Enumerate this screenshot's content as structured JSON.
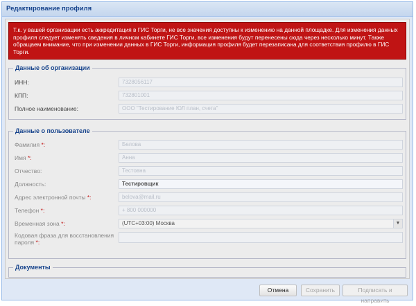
{
  "dialog": {
    "title": "Редактирование профиля"
  },
  "alert": {
    "text": "Т.к. у вашей организации есть аккредитация в ГИС Торги, не все значения доступны к изменению на данной площадке. Для изменения данных профиля следует изменять сведения в личном кабинете ГИС Торги, все изменения будут перенесены сюда через несколько минут. Также обращаем внимание, что при изменении данных в ГИС Торги, информация профиля будет перезаписана для соответствия профилю в ГИС Торги."
  },
  "org": {
    "legend": "Данные об организации",
    "inn_label": "ИНН:",
    "inn_value": "7328056117",
    "kpp_label": "КПП:",
    "kpp_value": "732801001",
    "fullname_label": "Полное наименование:",
    "fullname_value": "ООО \"Тестирование ЮЛ план, счета\""
  },
  "user": {
    "legend": "Данные о пользователе",
    "last_name_label": "Фамилия",
    "last_name_value": "Белова",
    "first_name_label": "Имя",
    "first_name_value": "Анна",
    "patronymic_label": "Отчество:",
    "patronymic_value": "Тестовна",
    "position_label": "Должность:",
    "position_value": "Тестировщик",
    "email_label": "Адрес электронной почты",
    "email_value": "belova@mail.ru",
    "phone_label": "Телефон",
    "phone_value": "+ 800 000000",
    "timezone_label": "Временная зона",
    "timezone_value": "(UTC+03:00) Москва",
    "phrase_label": "Кодовая фраза для восстановления пароля",
    "phrase_value": ""
  },
  "docs": {
    "legend": "Документы"
  },
  "buttons": {
    "cancel": "Отмена",
    "save": "Сохранить",
    "sign_send": "Подписать и направить"
  }
}
